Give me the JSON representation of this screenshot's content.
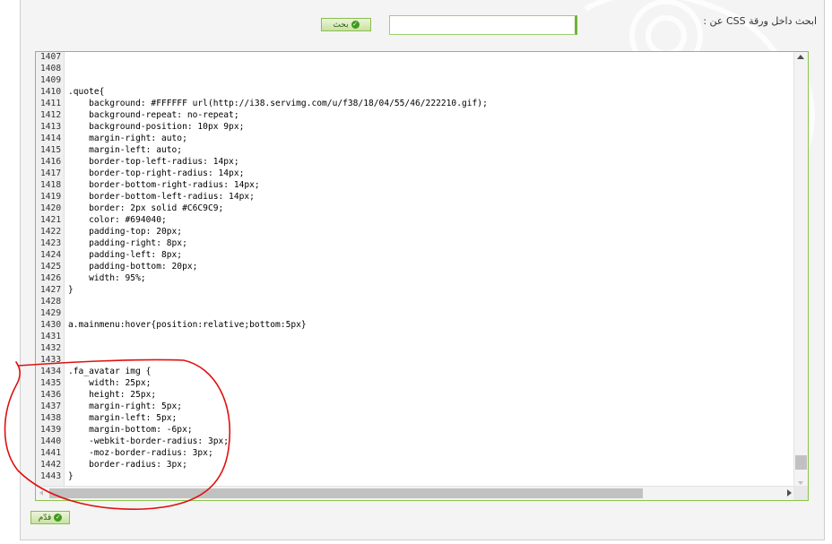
{
  "search": {
    "label": "ابحث داخل ورقة CSS عن :",
    "value": "",
    "button_label": "بحث"
  },
  "submit": {
    "label": "قدّم"
  },
  "editor": {
    "lines": [
      {
        "n": "1407",
        "code": ""
      },
      {
        "n": "1408",
        "code": ""
      },
      {
        "n": "1409",
        "code": ""
      },
      {
        "n": "1410",
        "code": ".quote{"
      },
      {
        "n": "1411",
        "code": "    background: #FFFFFF url(http://i38.servimg.com/u/f38/18/04/55/46/222210.gif);"
      },
      {
        "n": "1412",
        "code": "    background-repeat: no-repeat;"
      },
      {
        "n": "1413",
        "code": "    background-position: 10px 9px;"
      },
      {
        "n": "1414",
        "code": "    margin-right: auto;"
      },
      {
        "n": "1415",
        "code": "    margin-left: auto;"
      },
      {
        "n": "1416",
        "code": "    border-top-left-radius: 14px;"
      },
      {
        "n": "1417",
        "code": "    border-top-right-radius: 14px;"
      },
      {
        "n": "1418",
        "code": "    border-bottom-right-radius: 14px;"
      },
      {
        "n": "1419",
        "code": "    border-bottom-left-radius: 14px;"
      },
      {
        "n": "1420",
        "code": "    border: 2px solid #C6C9C9;"
      },
      {
        "n": "1421",
        "code": "    color: #694040;"
      },
      {
        "n": "1422",
        "code": "    padding-top: 20px;"
      },
      {
        "n": "1423",
        "code": "    padding-right: 8px;"
      },
      {
        "n": "1424",
        "code": "    padding-left: 8px;"
      },
      {
        "n": "1425",
        "code": "    padding-bottom: 20px;"
      },
      {
        "n": "1426",
        "code": "    width: 95%;"
      },
      {
        "n": "1427",
        "code": "}"
      },
      {
        "n": "1428",
        "code": ""
      },
      {
        "n": "1429",
        "code": ""
      },
      {
        "n": "1430",
        "code": "a.mainmenu:hover{position:relative;bottom:5px}"
      },
      {
        "n": "1431",
        "code": ""
      },
      {
        "n": "1432",
        "code": ""
      },
      {
        "n": "1433",
        "code": ""
      },
      {
        "n": "1434",
        "code": ".fa_avatar img {"
      },
      {
        "n": "1435",
        "code": "    width: 25px;"
      },
      {
        "n": "1436",
        "code": "    height: 25px;"
      },
      {
        "n": "1437",
        "code": "    margin-right: 5px;"
      },
      {
        "n": "1438",
        "code": "    margin-left: 5px;"
      },
      {
        "n": "1439",
        "code": "    margin-bottom: -6px;"
      },
      {
        "n": "1440",
        "code": "    -webkit-border-radius: 3px;"
      },
      {
        "n": "1441",
        "code": "    -moz-border-radius: 3px;"
      },
      {
        "n": "1442",
        "code": "    border-radius: 3px;"
      },
      {
        "n": "1443",
        "code": "}"
      }
    ]
  },
  "colors": {
    "accent_green": "#8bc34a",
    "annotation_red": "#e01010"
  },
  "icons": {
    "search_button_icon": "check-circle-icon",
    "submit_button_icon": "check-circle-icon"
  }
}
